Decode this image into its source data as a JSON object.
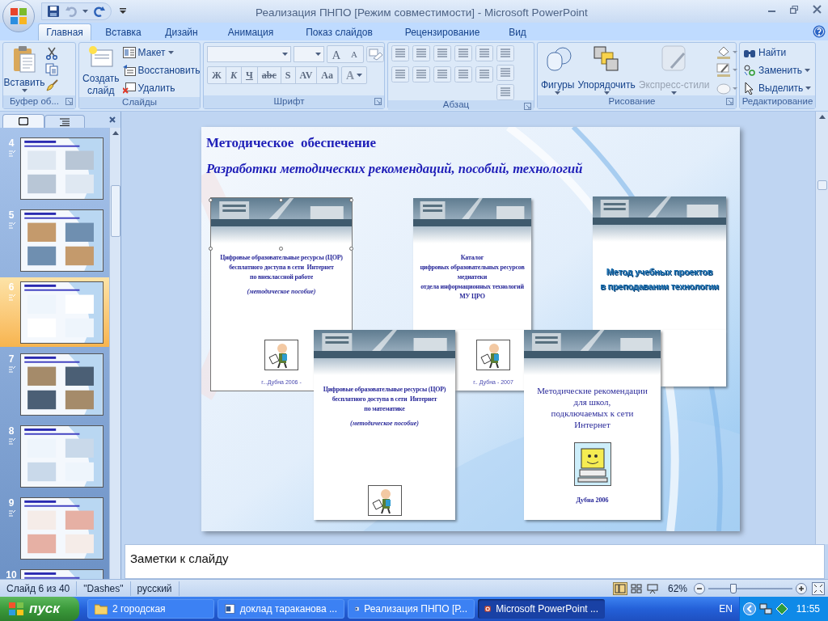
{
  "window": {
    "title": "Реализация ПНПО [Режим совместимости] - Microsoft PowerPoint"
  },
  "tabs": [
    {
      "label": "Главная",
      "selected": true
    },
    {
      "label": "Вставка",
      "selected": false
    },
    {
      "label": "Дизайн",
      "selected": false
    },
    {
      "label": "Анимация",
      "selected": false
    },
    {
      "label": "Показ слайдов",
      "selected": false
    },
    {
      "label": "Рецензирование",
      "selected": false
    },
    {
      "label": "Вид",
      "selected": false
    }
  ],
  "clipboard": {
    "label": "Буфер об...",
    "paste": "Вставить"
  },
  "slides_group": {
    "label": "Слайды",
    "new_slide": "Создать слайд",
    "layout": "Макет",
    "reset": "Восстановить",
    "delete": "Удалить"
  },
  "font_group": {
    "label": "Шрифт",
    "grow": "A",
    "shrink": "A",
    "buttons": [
      "Ж",
      "К",
      "Ч",
      "abc",
      "S",
      "AV",
      "Aa"
    ],
    "color_button": "A"
  },
  "paragraph_group": {
    "label": "Абзац"
  },
  "drawing_group": {
    "label": "Рисование",
    "buttons": [
      {
        "label": "Фигуры",
        "disabled": false
      },
      {
        "label": "Упорядочить",
        "disabled": false
      },
      {
        "label": "Экспресс-стили",
        "disabled": true
      }
    ]
  },
  "editing_group": {
    "label": "Редактирование",
    "find": "Найти",
    "replace": "Заменить",
    "select": "Выделить"
  },
  "slide_panel": {
    "slides": [
      {
        "number": "4",
        "selected": false
      },
      {
        "number": "5",
        "selected": false
      },
      {
        "number": "6",
        "selected": true
      },
      {
        "number": "7",
        "selected": false
      },
      {
        "number": "8",
        "selected": false
      },
      {
        "number": "9",
        "selected": false
      },
      {
        "number": "10",
        "selected": false
      }
    ]
  },
  "slide": {
    "title": "Методическое  обеспечение",
    "subtitle": "Разработки методических рекомендаций, пособий, технологий",
    "covers": [
      {
        "kind": "booklet",
        "selected": true,
        "lines": [
          "Цифровые образовательные ресурсы (ЦОР)",
          "бесплатного доступа в сети  Интернет",
          "по внеклассной работе"
        ],
        "note": "(методическое пособие)",
        "footer": "г...Дубна 2006 -"
      },
      {
        "kind": "booklet",
        "selected": false,
        "lines": [
          "Каталог",
          "цифровых образовательных ресурсов",
          "медиатеки",
          "отдела информационных технологий",
          "МУ ЦРО"
        ],
        "footer": "г.. Дубна - 2007"
      },
      {
        "kind": "wordart",
        "selected": false,
        "lines": [
          "Метод учебных проектов",
          "в преподавании технологии"
        ]
      },
      {
        "kind": "booklet",
        "selected": false,
        "lines": [
          "Цифровые образовательные ресурсы (ЦОР)",
          "бесплатного доступа в сети  Интернет",
          "по математике"
        ],
        "note": "(методическое пособие)"
      },
      {
        "kind": "plain",
        "selected": false,
        "lines": [
          "Методические рекомендации",
          "для школ,",
          "подключаемых к сети",
          "Интернет"
        ],
        "footer": "Дубна 2006"
      }
    ]
  },
  "notes": {
    "placeholder": "Заметки к слайду"
  },
  "status_bar": {
    "slide": "Слайд 6 из 40",
    "theme": "\"Dashes\"",
    "language": "русский",
    "zoom": "62%",
    "zoom_slider": {
      "level": 0.3
    }
  },
  "taskbar": {
    "start": "пуск",
    "tasks": [
      {
        "label": "2 городская",
        "kind": "folder",
        "selected": false
      },
      {
        "label": "доклад тараканова ...",
        "kind": "word",
        "selected": false
      },
      {
        "label": "Реализация ПНПО [Р...",
        "kind": "word",
        "selected": false
      },
      {
        "label": "Microsoft PowerPoint ...",
        "kind": "powerpoint",
        "selected": true
      }
    ],
    "language": "EN",
    "time": "11:55"
  }
}
